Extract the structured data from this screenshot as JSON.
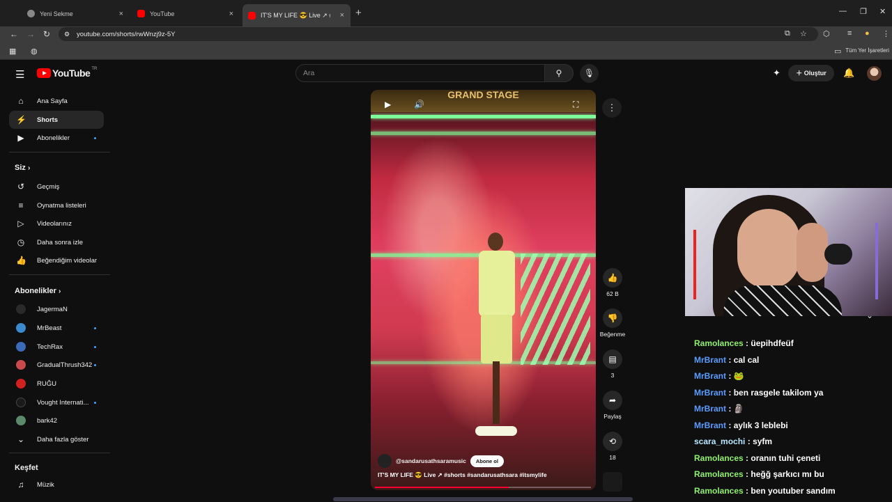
{
  "browser": {
    "tabs": [
      {
        "title": "Yeni Sekme",
        "close": "×"
      },
      {
        "title": "YouTube",
        "close": "×"
      },
      {
        "title": "IT'S MY LIFE 😎 Live ↗ #sl",
        "close": "×"
      }
    ],
    "new_tab": "+",
    "url": "youtube.com/shorts/rwWnzj9z-5Y",
    "bookmarks_label": "Tüm Yer İşaretleri"
  },
  "header": {
    "logo_text": "YouTube",
    "country": "TR",
    "search_placeholder": "Ara",
    "create_label": "Oluştur"
  },
  "sidebar": {
    "main": [
      {
        "label": "Ana Sayfa",
        "icon": "home-icon"
      },
      {
        "label": "Shorts",
        "icon": "shorts-icon"
      },
      {
        "label": "Abonelikler",
        "icon": "subscriptions-icon"
      }
    ],
    "you_header": "Siz",
    "you": [
      {
        "label": "Geçmiş"
      },
      {
        "label": "Oynatma listeleri"
      },
      {
        "label": "Videolarınız"
      },
      {
        "label": "Daha sonra izle"
      },
      {
        "label": "Beğendiğim videolar"
      }
    ],
    "subs_header": "Abonelikler",
    "subs": [
      {
        "label": "JagermaN",
        "color": "#2a2a2a"
      },
      {
        "label": "MrBeast",
        "color": "#3a8ad0"
      },
      {
        "label": "TechRax",
        "color": "#3a6ab8"
      },
      {
        "label": "GradualThrush342",
        "color": "#c84a4a"
      },
      {
        "label": "RUĞU",
        "color": "#d02020"
      },
      {
        "label": "Vought Internati...",
        "color": "#1a1a1a"
      },
      {
        "label": "bark42",
        "color": "#5a8a6a"
      }
    ],
    "show_more": "Daha fazla göster",
    "explore_header": "Keşfet",
    "explore": [
      {
        "label": "Müzik"
      }
    ]
  },
  "short": {
    "stage_text": "GRAND STAGE",
    "channel": "@sandarusathsaramusic",
    "subscribe": "Abone ol",
    "title": "IT'S MY LIFE 😎 Live ↗ #shorts #sandarusathsara #itsmylife",
    "progress": 0.62
  },
  "actions": {
    "likes": "62 B",
    "dislike": "Beğenme",
    "comments": "3",
    "share": "Paylaş",
    "remix": "18"
  },
  "chat": [
    {
      "user": "Ramolances",
      "msg": "üepihdfeüf",
      "color": "#8ff06a"
    },
    {
      "user": "MrBrant",
      "msg": "cal cal",
      "color": "#5a9cff"
    },
    {
      "user": "MrBrant",
      "msg": "🐸",
      "color": "#5a9cff"
    },
    {
      "user": "MrBrant",
      "msg": "ben rasgele takilom ya",
      "color": "#5a9cff"
    },
    {
      "user": "MrBrant",
      "msg": "🗿",
      "color": "#5a9cff"
    },
    {
      "user": "MrBrant",
      "msg": "aylık 3 leblebi",
      "color": "#5a9cff"
    },
    {
      "user": "scara_mochi",
      "msg": "syfm",
      "color": "#b8e8ff"
    },
    {
      "user": "Ramolances",
      "msg": "oranın tuhi çeneti",
      "color": "#8ff06a"
    },
    {
      "user": "Ramolances",
      "msg": "heğğ şarkıcı mı bu",
      "color": "#8ff06a"
    },
    {
      "user": "Ramolances",
      "msg": "ben youtuber sandım",
      "color": "#8ff06a"
    }
  ]
}
